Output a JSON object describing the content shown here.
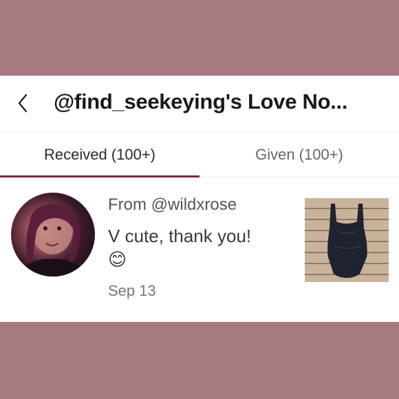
{
  "header": {
    "title": "@find_seekeying's Love No...",
    "back_icon": "chevron-left-icon"
  },
  "tabs": [
    {
      "label": "Received (100+)",
      "active": true
    },
    {
      "label": "Given (100+)",
      "active": false
    }
  ],
  "note": {
    "from": "From @wildxrose",
    "message": "V cute, thank you!",
    "emoji": "😊",
    "date": "Sep 13"
  },
  "colors": {
    "background": "#a67b80",
    "accent": "#7a2a35"
  }
}
